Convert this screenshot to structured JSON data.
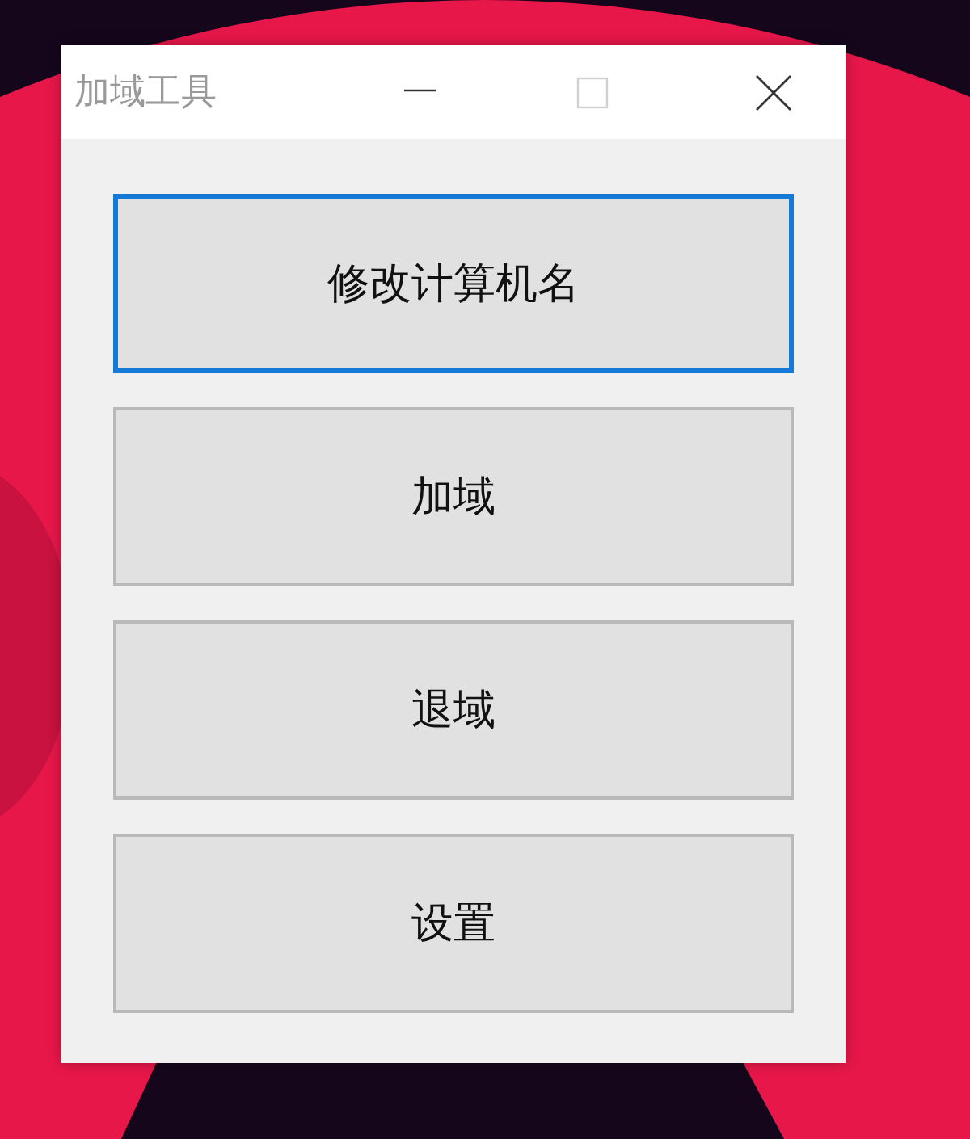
{
  "window": {
    "title": "加域工具",
    "active": false
  },
  "caption_buttons": [
    {
      "kind": "minimize",
      "disabled": false
    },
    {
      "kind": "maximize",
      "disabled": true
    },
    {
      "kind": "close",
      "disabled": false
    }
  ],
  "buttons": [
    {
      "label": "修改计算机名",
      "focused": true
    },
    {
      "label": "加域",
      "focused": false
    },
    {
      "label": "退域",
      "focused": false
    },
    {
      "label": "设置",
      "focused": false
    }
  ]
}
